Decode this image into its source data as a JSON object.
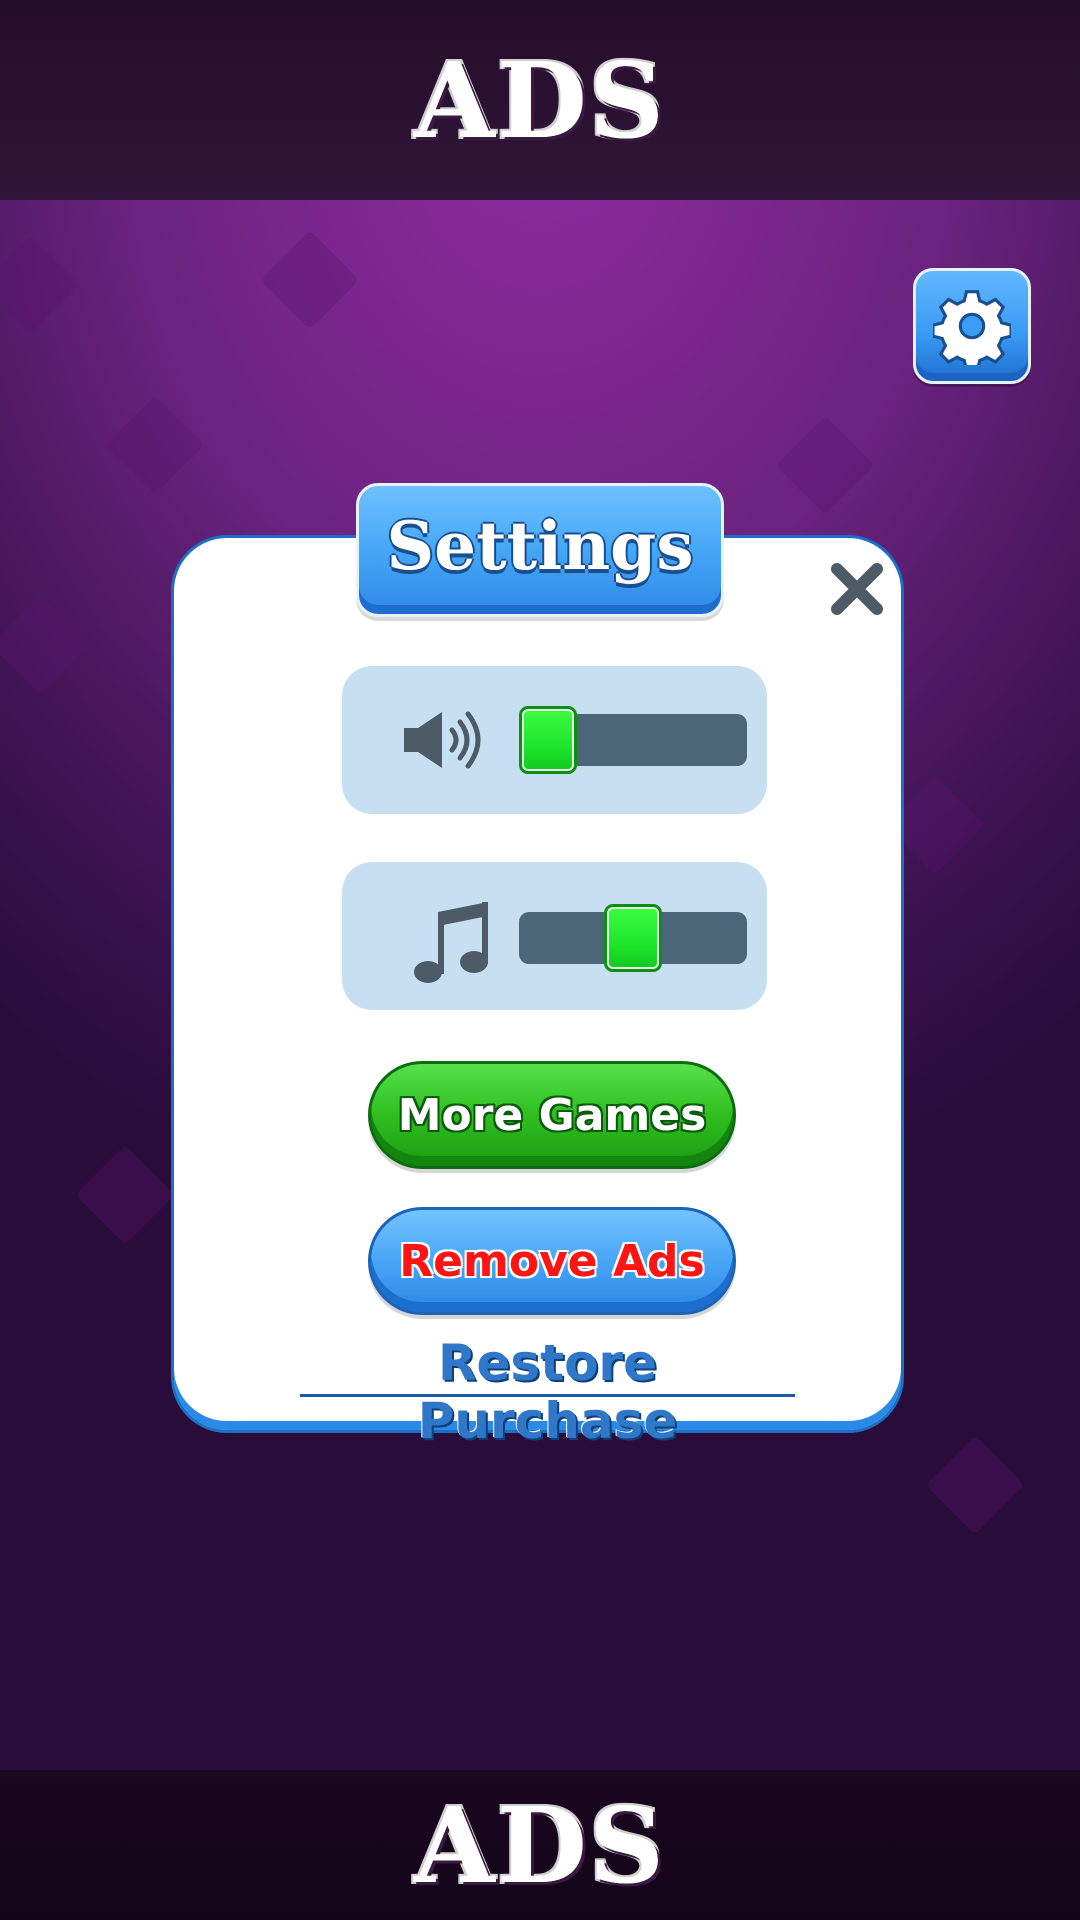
{
  "ads": {
    "top_label": "ADS",
    "bottom_label": "ADS"
  },
  "settings_button": {
    "icon": "gear-icon"
  },
  "dialog": {
    "title": "Settings",
    "close_icon": "close-icon",
    "sound": {
      "icon": "speaker-icon",
      "volume": 0.0
    },
    "music": {
      "icon": "music-note-icon",
      "volume": 0.5
    },
    "more_games_label": "More Games",
    "remove_ads_label": "Remove Ads",
    "restore_purchase_label": "Restore Purchase"
  },
  "colors": {
    "accent_blue": "#3a9cf4",
    "knob_green": "#1ee62c",
    "track": "#4a6678",
    "remove_ads_text": "#ff1414"
  }
}
